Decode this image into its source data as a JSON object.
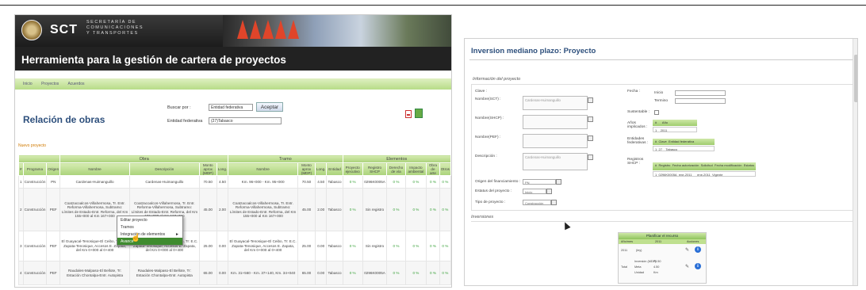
{
  "left": {
    "brand": "SCT",
    "secretaria_lines": [
      "SECRETARÍA DE",
      "COMUNICACIONES",
      "Y TRANSPORTES"
    ],
    "app_title": "Herramienta para la gestión de cartera de proyectos",
    "nav": [
      "Inicio",
      "Proyectos",
      "Acuerdos"
    ],
    "page_title": "Relación de obras",
    "buscar_label": "Buscar por :",
    "buscar_value": "Entidad federativa",
    "aceptar_label": "Aceptar",
    "entidad_label": "Entidad federativa",
    "entidad_value": "(27)Tabasco",
    "nuevo_link": "Nuevo proyecto",
    "group_headers": [
      "Obra",
      "Tramo",
      "Elementos"
    ],
    "columns": [
      "#",
      "Programa",
      "Origen",
      "Nombre",
      "Descripción",
      "Monto aprox (MDP)",
      "Long.",
      "Nombre",
      "Monto aprox (MDP)",
      "Long.",
      "Entidad",
      "Proyecto ejecutivo",
      "Registro SHCP",
      "Derecho de vía",
      "Impacto ambiental",
      "Obra de arte",
      "Otros"
    ],
    "rows": [
      {
        "n": "1",
        "programa": "Construcción",
        "origen": "PN",
        "nombre": "Cardenas-Huimanguillo",
        "descripcion": "Cardenas-Huimanguillo",
        "monto": "70.50",
        "long": "4.50",
        "t_nombre": "Km. 96+000 - Km. 95+000",
        "t_monto": "70.50",
        "t_long": "4.50",
        "entidad": "Tabasco",
        "proyecto": "0 %",
        "registro": "0296K0005A",
        "derecho": "0 %",
        "impacto": "0 %",
        "obra": "0 %",
        "otros": "0 %"
      },
      {
        "n": "2",
        "programa": "Construcción",
        "origen": "PEF",
        "nombre": "Coatzacoalcos-Villahermosa, Tr. Entr. Reforma-Villahermosa, Subtramo: Límites de Estado-Entr. Reforma, del Km 155+000 al Km 167+000",
        "descripcion": "Coatzacoalcos-Villahermosa, Tr. Entr. Reforma-Villahermosa, Subtramo: Límites de Estado-Entr. Reforma, del Km 155+000 al Km 167+000",
        "monto": "45.00",
        "long": "2.00",
        "t_nombre": "Coatzacoalcos-Villahermosa, Tr. Entr. Reforma-Villahermosa, Subtramo: Límites de Estado-Entr. Reforma, del Km 155+000 al Km 167+000",
        "t_monto": "45.00",
        "t_long": "2.00",
        "entidad": "Tabasco",
        "proyecto": "0 %",
        "registro": "Sin registro",
        "derecho": "0 %",
        "impacto": "0 %",
        "obra": "0 %",
        "otros": "0 %"
      },
      {
        "n": "3",
        "programa": "Construcción",
        "origen": "PEF",
        "nombre": "El Guayacal-Tenosique-El Ceibo, Tr: E.C. Zapata-Tenosique, Accesos E. Zapata, del Km 0+000 al 0+400",
        "descripcion": "El Guayacal-Tenosique-El Ceibo, Tr: E.C. Zapata-Tenosique, Accesos E. Zapata, del Km 0+000 al 0+400",
        "monto": "25.00",
        "long": "0.00",
        "t_nombre": "El Guayacal-Tenosique-El Ceibo, Tr: E.C. Zapata-Tenosique, Accesos E. Zapata, del Km 0+000 al 0+400",
        "t_monto": "25.00",
        "t_long": "0.00",
        "entidad": "Tabasco",
        "proyecto": "0 %",
        "registro": "Sin registro",
        "derecho": "0 %",
        "impacto": "0 %",
        "obra": "0 %",
        "otros": "0 %"
      },
      {
        "n": "4",
        "programa": "Construcción",
        "origen": "PEF",
        "nombre": "Raudales-Malpaso-El Bellote, Tr: Estación Chontalpa-Entr. Autopista",
        "descripcion": "Raudales-Malpaso-El Bellote, Tr: Estación Chontalpa-Entr. Autopista",
        "monto": "65.00",
        "long": "0.00",
        "t_nombre": "Km. 31+560 - Km. 37+140, Km. 34+040",
        "t_monto": "65.00",
        "t_long": "0.00",
        "entidad": "Tabasco",
        "proyecto": "0 %",
        "registro": "0296K0005A",
        "derecho": "0 %",
        "impacto": "0 %",
        "obra": "0 %",
        "otros": "0 %"
      }
    ],
    "context_menu": {
      "items": [
        "Editar proyecto",
        "Tramos",
        "Integración de elementos",
        "Avance"
      ],
      "arrow": "►",
      "highlighted_index": 3
    },
    "cursor_glyph": "☝"
  },
  "right": {
    "title": "Inversion mediano plazo: Proyecto",
    "info_label": "Información del proyecto",
    "clave_label": "Clave :",
    "nombre_sct_label": "Nombre(SCT) :",
    "nombre_sct_value": "Cardenas-Huimanguillo",
    "nombre_shcp_label": "Nombre(SHCP) :",
    "nombre_pef_label": "Nombre(PEF) :",
    "descripcion_label": "Descripción :",
    "descripcion_value": "Cardenas-Huimanguillo",
    "origen_label": "Origen del financiamiento :",
    "origen_value": "PN",
    "estatus_label": "Estatus del proyecto :",
    "estatus_value": "Inicio",
    "tipo_label": "Tipo de proyecto :",
    "tipo_value": "Construcción",
    "fecha_label": "Fecha :",
    "inicio_label": "Inicio",
    "termino_label": "Termino",
    "sustentable_label": "Sustentable :",
    "anios_label": "Años implicados :",
    "anios_headers": [
      "#",
      "Año"
    ],
    "anios_row": [
      "1",
      "2011"
    ],
    "entidades_label": "Entidades federativas :",
    "entidades_headers": [
      "#",
      "Clave",
      "Entidad federativa"
    ],
    "entidades_row": [
      "1",
      "27",
      "Tabasco"
    ],
    "registros_label": "Registros SHCP :",
    "registros_headers": [
      "#",
      "Registro",
      "Fecha autorización",
      "Solicitud",
      "Fecha modificación",
      "Estatus"
    ],
    "registros_row": [
      "1",
      "0296K0005A",
      "ene-2011",
      "",
      "ene-2011",
      "Vigente"
    ],
    "inversiones_label": "Inversiones",
    "plan": {
      "title": "Planificar el recurso",
      "cols": [
        "Año/mes",
        "2011",
        "Acciones"
      ],
      "row1": [
        "2011",
        "(ley)"
      ],
      "sub_labels": [
        "Inversión (MDP)",
        "Meta",
        "Unidad"
      ],
      "sub_values": [
        "70.50",
        "4.50",
        "Km"
      ],
      "total_label": "Total"
    },
    "icons": {
      "info": "i",
      "pencil": "✎"
    }
  }
}
